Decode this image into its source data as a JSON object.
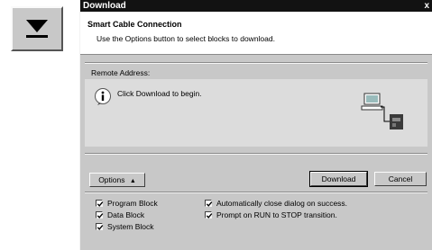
{
  "toolbar_icon": {
    "name": "download-arrow-icon"
  },
  "dialog": {
    "title": "Download",
    "close_glyph": "x",
    "header_title": "Smart Cable Connection",
    "header_subtitle": "Use the Options button to select blocks to download.",
    "remote_address_label": "Remote Address:",
    "info_message": "Click Download to begin.",
    "buttons": {
      "options": "Options",
      "options_glyph": "▲",
      "download": "Download",
      "cancel": "Cancel"
    },
    "options_left": [
      {
        "label": "Program Block",
        "checked": true
      },
      {
        "label": "Data Block",
        "checked": true
      },
      {
        "label": "System Block",
        "checked": true
      }
    ],
    "options_right": [
      {
        "label": "Automatically close dialog on success.",
        "checked": true
      },
      {
        "label": "Prompt on RUN to STOP transition.",
        "checked": true
      }
    ]
  }
}
